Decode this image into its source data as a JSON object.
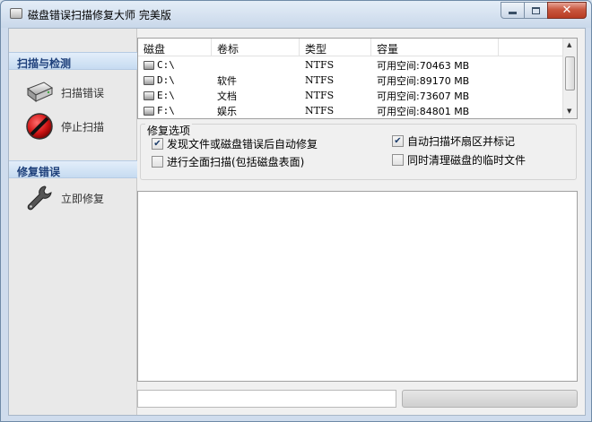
{
  "window": {
    "title": "磁盘错误扫描修复大师 完美版"
  },
  "sidebar": {
    "sections": [
      {
        "header": "扫描与检测",
        "items": [
          {
            "label": "扫描错误"
          },
          {
            "label": "停止扫描"
          }
        ]
      },
      {
        "header": "修复错误",
        "items": [
          {
            "label": "立即修复"
          }
        ]
      }
    ]
  },
  "disk_list": {
    "columns": [
      "磁盘",
      "卷标",
      "类型",
      "容量"
    ],
    "rows": [
      {
        "disk": "C:\\",
        "label": "",
        "type": "NTFS",
        "capacity": "可用空间:70463 MB"
      },
      {
        "disk": "D:\\",
        "label": "软件",
        "type": "NTFS",
        "capacity": "可用空间:89170 MB"
      },
      {
        "disk": "E:\\",
        "label": "文档",
        "type": "NTFS",
        "capacity": "可用空间:73607 MB"
      },
      {
        "disk": "F:\\",
        "label": "娱乐",
        "type": "NTFS",
        "capacity": "可用空间:84801 MB"
      }
    ]
  },
  "options": {
    "title": "修复选项",
    "items": [
      {
        "label": "发现文件或磁盘错误后自动修复",
        "checked": true
      },
      {
        "label": "自动扫描坏扇区并标记",
        "checked": true
      },
      {
        "label": "进行全面扫描(包括磁盘表面)",
        "checked": false
      },
      {
        "label": "同时清理磁盘的临时文件",
        "checked": false
      }
    ]
  },
  "status": {
    "text": "",
    "progress": 0
  },
  "icons": {
    "scan": "hard-disk-icon",
    "stop": "stop-icon",
    "repair": "wrench-icon"
  }
}
